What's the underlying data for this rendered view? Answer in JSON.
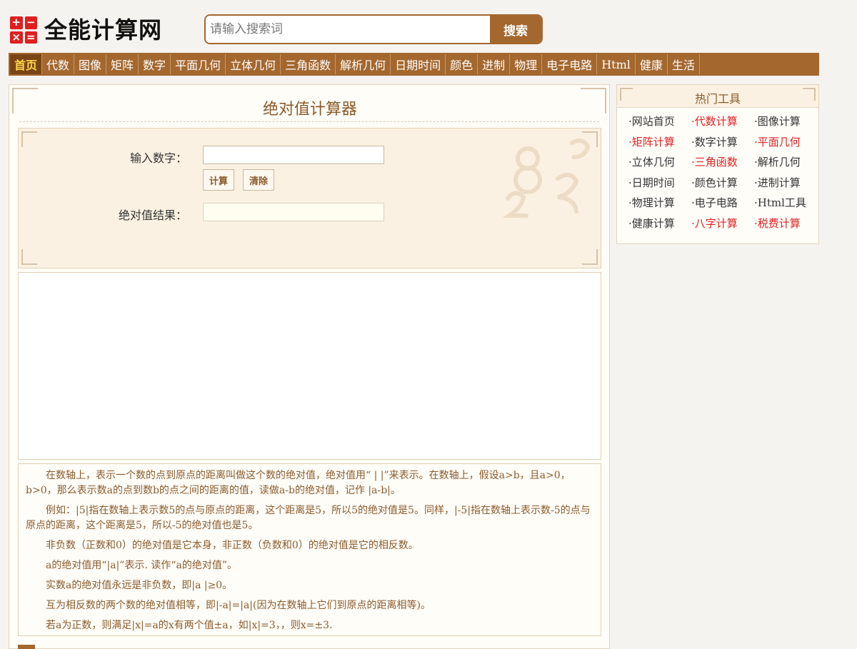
{
  "header": {
    "logo_text": "全能计算网",
    "logo_cells": [
      "+",
      "−",
      "×",
      "="
    ],
    "search_placeholder": "请输入搜索词",
    "search_button": "搜索"
  },
  "nav": {
    "items": [
      "首页",
      "代数",
      "图像",
      "矩阵",
      "数字",
      "平面几何",
      "立体几何",
      "三角函数",
      "解析几何",
      "日期时间",
      "颜色",
      "进制",
      "物理",
      "电子电路",
      "Html",
      "健康",
      "生活"
    ],
    "active_index": 0
  },
  "main": {
    "title": "绝对值计算器",
    "input_label": "输入数字：",
    "input_value": "",
    "calc_button": "计算",
    "clear_button": "清除",
    "result_label": "绝对值结果：",
    "result_value": "",
    "description": [
      "在数轴上，表示一个数的点到原点的距离叫做这个数的绝对值，绝对值用“ | |”来表示。在数轴上，假设a>b，且a>0，b>0，那么表示数a的点到数b的点之间的距离的值，读做a-b的绝对值，记作 |a-b|。",
      "例如：|5|指在数轴上表示数5的点与原点的距离，这个距离是5，所以5的绝对值是5。同样，|-5|指在数轴上表示数-5的点与原点的距离，这个距离是5，所以-5的绝对值也是5。",
      "非负数（正数和0）的绝对值是它本身，非正数（负数和0）的绝对值是它的相反数。",
      "a的绝对值用“|a|”表示. 读作“a的绝对值”。",
      "实数a的绝对值永远是非负数，即|a |≥0。",
      "互为相反数的两个数的绝对值相等，即|-a|=|a|(因为在数轴上它们到原点的距离相等)。",
      "若a为正数，则满足|x|=a的x有两个值±a，如|x|=3，，则x=±3."
    ]
  },
  "sidebar": {
    "title": "热门工具",
    "links": [
      {
        "label": "·网站首页",
        "red": false
      },
      {
        "label": "·代数计算",
        "red": true
      },
      {
        "label": "·图像计算",
        "red": false
      },
      {
        "label": "·矩阵计算",
        "red": true
      },
      {
        "label": "·数字计算",
        "red": false
      },
      {
        "label": "·平面几何",
        "red": true
      },
      {
        "label": "·立体几何",
        "red": false
      },
      {
        "label": "·三角函数",
        "red": true
      },
      {
        "label": "·解析几何",
        "red": false
      },
      {
        "label": "·日期时间",
        "red": false
      },
      {
        "label": "·颜色计算",
        "red": false
      },
      {
        "label": "·进制计算",
        "red": false
      },
      {
        "label": "·物理计算",
        "red": false
      },
      {
        "label": "·电子电路",
        "red": false
      },
      {
        "label": "·Html工具",
        "red": false
      },
      {
        "label": "·健康计算",
        "red": false
      },
      {
        "label": "·八字计算",
        "red": true
      },
      {
        "label": "·税费计算",
        "red": true
      }
    ]
  },
  "colors": {
    "brand": "#a4672e",
    "nav_active_bg": "#7a4515",
    "nav_active_text": "#ffd84a",
    "highlight_red": "#e01f1f",
    "text_brown": "#8b5a2b"
  }
}
